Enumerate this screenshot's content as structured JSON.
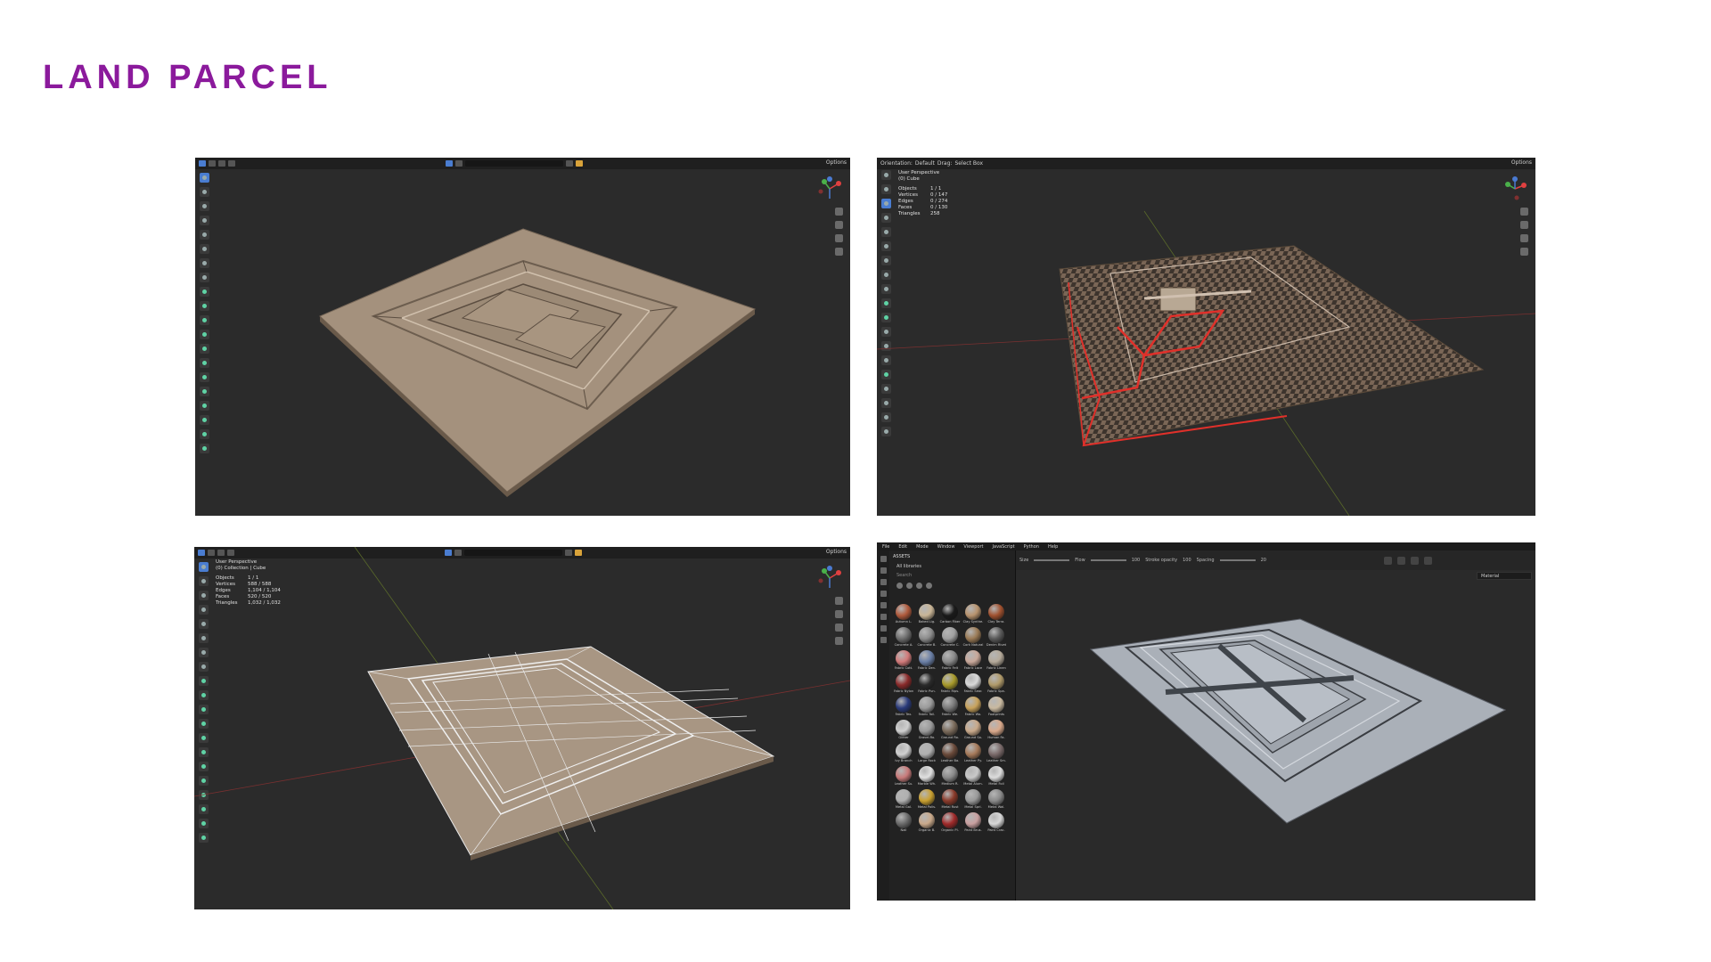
{
  "page_title": "LAND PARCEL",
  "panels": [
    {
      "id": "blender-object",
      "header": {
        "options_label": "Options"
      }
    },
    {
      "id": "blender-edit",
      "header": {
        "orientation_label": "Orientation:",
        "orientation_value": "Default",
        "drag_label": "Drag:",
        "drag_value": "Select Box",
        "options_label": "Options"
      },
      "stats": {
        "view": "User Perspective",
        "object": "(0) Cube",
        "rows": [
          {
            "label": "Objects",
            "value": "1 / 1"
          },
          {
            "label": "Vertices",
            "value": "0 / 147"
          },
          {
            "label": "Edges",
            "value": "0 / 274"
          },
          {
            "label": "Faces",
            "value": "0 / 130"
          },
          {
            "label": "Triangles",
            "value": "258"
          }
        ]
      }
    },
    {
      "id": "blender-wire",
      "header": {
        "options_label": "Options"
      },
      "stats": {
        "view": "User Perspective",
        "object": "(0) Collection | Cube",
        "rows": [
          {
            "label": "Objects",
            "value": "1 / 1"
          },
          {
            "label": "Vertices",
            "value": "588 / 588"
          },
          {
            "label": "Edges",
            "value": "1,104 / 1,104"
          },
          {
            "label": "Faces",
            "value": "520 / 520"
          },
          {
            "label": "Triangles",
            "value": "1,032 / 1,032"
          }
        ]
      }
    },
    {
      "id": "painter",
      "menu": [
        "File",
        "Edit",
        "Mode",
        "Window",
        "Viewport",
        "JavaScript",
        "Python",
        "Help"
      ],
      "toolbar": {
        "size_label": "Size",
        "flow_label": "Flow",
        "flow_value": "100",
        "stroke_opacity_label": "Stroke opacity",
        "stroke_opacity_value": "100",
        "spacing_label": "Spacing",
        "spacing_value": "20"
      },
      "material_select": "Material",
      "assets": {
        "title": "ASSETS",
        "library": "All libraries",
        "search_placeholder": "Search",
        "materials": [
          {
            "name": "Autumn L.",
            "color": "#b05a3c"
          },
          {
            "name": "Baked Lig.",
            "color": "#c9b596"
          },
          {
            "name": "Carbon Fiber",
            "color": "#1a1a1a"
          },
          {
            "name": "Clay Synthe.",
            "color": "#b8936e"
          },
          {
            "name": "Clay Terra.",
            "color": "#a0512f"
          },
          {
            "name": "Concrete A.",
            "color": "#6e6e6e"
          },
          {
            "name": "Concrete B.",
            "color": "#8c8c8c"
          },
          {
            "name": "Concrete C.",
            "color": "#a0a0a0"
          },
          {
            "name": "Cork Natural",
            "color": "#9a7a55"
          },
          {
            "name": "Denim Rivet",
            "color": "#5a5a5a"
          },
          {
            "name": "Fabric Cott.",
            "color": "#d27a7a"
          },
          {
            "name": "Fabric Den.",
            "color": "#6a7fa6"
          },
          {
            "name": "Fabric Felt",
            "color": "#8a8a8a"
          },
          {
            "name": "Fabric Lace",
            "color": "#c9a89a"
          },
          {
            "name": "Fabric Linen",
            "color": "#b5aa9a"
          },
          {
            "name": "Fabric Nylon",
            "color": "#8a2a2a"
          },
          {
            "name": "Fabric Pun.",
            "color": "#2a2a2a"
          },
          {
            "name": "Fabric Rips.",
            "color": "#a89a2a"
          },
          {
            "name": "Fabric Sear.",
            "color": "#d8d8d8"
          },
          {
            "name": "Fabric Spa.",
            "color": "#b09a6a"
          },
          {
            "name": "Fabric Tex.",
            "color": "#2a3a7a"
          },
          {
            "name": "Fabric Toil.",
            "color": "#9a9a9a"
          },
          {
            "name": "Fabric We.",
            "color": "#7a7a7a"
          },
          {
            "name": "Fabric Wo.",
            "color": "#c8a25a"
          },
          {
            "name": "Footprints",
            "color": "#c9b9a0"
          },
          {
            "name": "Glitter",
            "color": "#cfcfcf"
          },
          {
            "name": "Gravel.Ro.",
            "color": "#9a9a9a"
          },
          {
            "name": "Ground Ro.",
            "color": "#7a6a5a"
          },
          {
            "name": "Ground Sa.",
            "color": "#c9a98a"
          },
          {
            "name": "Human Fa.",
            "color": "#d9a88a"
          },
          {
            "name": "Ivy Branch",
            "color": "#d0d0d0"
          },
          {
            "name": "Large Rock",
            "color": "#b0b0b0"
          },
          {
            "name": "Leather Ba.",
            "color": "#6a4a3a"
          },
          {
            "name": "Leather Py.",
            "color": "#a67a5a"
          },
          {
            "name": "Leather Sm.",
            "color": "#7a6a6a"
          },
          {
            "name": "Leather Su.",
            "color": "#c87a7a"
          },
          {
            "name": "Marble Wh.",
            "color": "#e0e0e0"
          },
          {
            "name": "Medium R.",
            "color": "#8a8a8a"
          },
          {
            "name": "Metal Alum.",
            "color": "#c8c8c8"
          },
          {
            "name": "Metal Foil",
            "color": "#dcdcdc"
          },
          {
            "name": "Metal Gal.",
            "color": "#b0b0b0"
          },
          {
            "name": "Metal Polis.",
            "color": "#c9a030"
          },
          {
            "name": "Metal Rust",
            "color": "#8a3a2a"
          },
          {
            "name": "Metal Spri.",
            "color": "#9a9a9a"
          },
          {
            "name": "Metal Wal.",
            "color": "#8a8a8a"
          },
          {
            "name": "Nail",
            "color": "#6a6a6a"
          },
          {
            "name": "Organic B.",
            "color": "#c9a98a"
          },
          {
            "name": "Organic Pl.",
            "color": "#a02a2a"
          },
          {
            "name": "Paint Brus.",
            "color": "#c9a0a0"
          },
          {
            "name": "Paint Crac.",
            "color": "#d8d8d8"
          }
        ]
      }
    }
  ],
  "colors": {
    "title": "#8b1a9c",
    "viewport_bg": "#2b2b2b",
    "clay": "#a4917d",
    "edit_highlight": "#e0302a",
    "painter_mesh": "#aab0b8"
  }
}
